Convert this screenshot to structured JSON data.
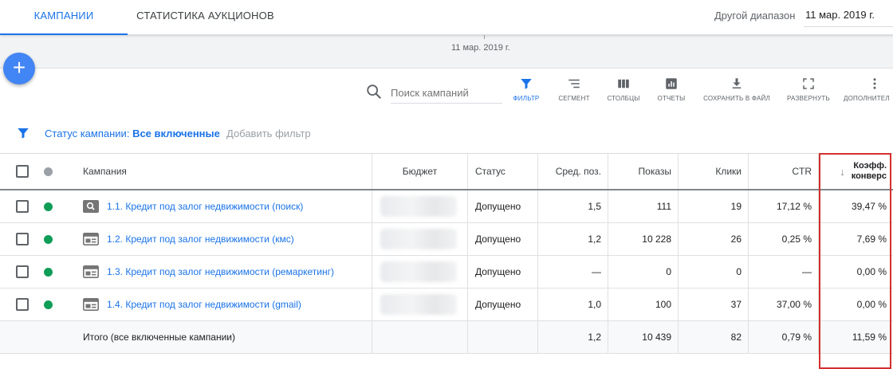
{
  "tabs": [
    {
      "label": "КАМПАНИИ"
    },
    {
      "label": "СТАТИСТИКА АУКЦИОНОВ"
    }
  ],
  "date_range": {
    "label": "Другой диапазон",
    "value": "11 мар. 2019 г."
  },
  "timeline": {
    "date": "11 мар. 2019 г."
  },
  "fab": {
    "label": "+"
  },
  "toolbar": {
    "search_placeholder": "Поиск кампаний",
    "filter": "ФИЛЬТР",
    "segment": "СЕГМЕНТ",
    "columns": "СТОЛБЦЫ",
    "reports": "ОТЧЕТЫ",
    "save": "СОХРАНИТЬ В ФАЙЛ",
    "expand": "РАЗВЕРНУТЬ",
    "more": "ДОПОЛНИТЕЛ"
  },
  "filter_bar": {
    "label": "Статус кампании:",
    "value": "Все включенные",
    "add": "Добавить фильтр"
  },
  "table": {
    "headers": {
      "campaign": "Кампания",
      "budget": "Бюджет",
      "status": "Статус",
      "avg_pos": "Сред. поз.",
      "impressions": "Показы",
      "clicks": "Клики",
      "ctr": "CTR",
      "conv_line1": "Коэфф.",
      "conv_line2": "конверс"
    },
    "rows": [
      {
        "name": "1.1. Кредит под залог недвижимости (поиск)",
        "type_icon": "search-campaign-icon",
        "status": "Допущено",
        "avg_pos": "1,5",
        "impressions": "111",
        "clicks": "19",
        "ctr": "17,12 %",
        "conv": "39,47 %"
      },
      {
        "name": "1.2. Кредит под залог недвижимости (кмс)",
        "type_icon": "display-campaign-icon",
        "status": "Допущено",
        "avg_pos": "1,2",
        "impressions": "10 228",
        "clicks": "26",
        "ctr": "0,25 %",
        "conv": "7,69 %"
      },
      {
        "name": "1.3. Кредит под залог недвижимости (ремаркетинг)",
        "type_icon": "display-campaign-icon",
        "status": "Допущено",
        "avg_pos": "—",
        "impressions": "0",
        "clicks": "0",
        "ctr": "—",
        "conv": "0,00 %"
      },
      {
        "name": "1.4. Кредит под залог недвижимости (gmail)",
        "type_icon": "display-campaign-icon",
        "status": "Допущено",
        "avg_pos": "1,0",
        "impressions": "100",
        "clicks": "37",
        "ctr": "37,00 %",
        "conv": "0,00 %"
      }
    ],
    "total": {
      "label": "Итого (все включенные кампании)",
      "avg_pos": "1,2",
      "impressions": "10 439",
      "clicks": "82",
      "ctr": "0,79 %",
      "conv": "11,59 %"
    }
  },
  "colors": {
    "accent": "#1a73e8",
    "status_enabled": "#0f9d58",
    "highlight": "#d32f2f"
  }
}
